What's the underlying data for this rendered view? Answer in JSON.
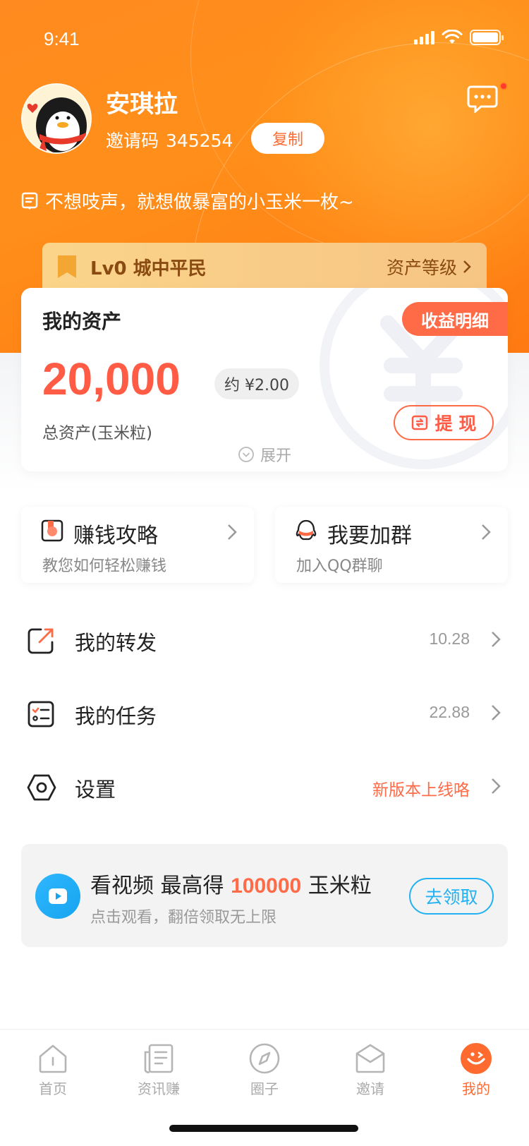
{
  "status_bar": {
    "time": "9:41"
  },
  "profile": {
    "name": "安琪拉",
    "invite_label": "邀请码",
    "invite_code": "345254",
    "copy_label": "复制",
    "signature": "不想吱声，就想做暴富的小玉米一枚~"
  },
  "level": {
    "title": "Lv0 城中平民",
    "link": "资产等级"
  },
  "assets": {
    "title": "我的资产",
    "detail_button": "收益明细",
    "value": "20,000",
    "approx": "约 ¥2.00",
    "subtitle": "总资产(玉米粒)",
    "withdraw_button": "提 现",
    "expand_label": "展开"
  },
  "quick_links": [
    {
      "title": "赚钱攻略",
      "subtitle": "教您如何轻松赚钱",
      "icon": "guide-icon"
    },
    {
      "title": "我要加群",
      "subtitle": "加入QQ群聊",
      "icon": "qq-icon"
    }
  ],
  "menu": [
    {
      "label": "我的转发",
      "value": "10.28",
      "icon": "share-icon"
    },
    {
      "label": "我的任务",
      "value": "22.88",
      "icon": "task-icon"
    },
    {
      "label": "设置",
      "value": "新版本上线咯",
      "icon": "settings-icon"
    }
  ],
  "promo": {
    "title_prefix": "看视频 最高得",
    "amount": "100000",
    "title_suffix": "玉米粒",
    "subtitle": "点击观看，翻倍领取无上限",
    "button": "去领取"
  },
  "tabs": [
    {
      "label": "首页",
      "icon": "home-icon"
    },
    {
      "label": "资讯赚",
      "icon": "news-icon"
    },
    {
      "label": "圈子",
      "icon": "compass-icon"
    },
    {
      "label": "邀请",
      "icon": "invite-icon"
    },
    {
      "label": "我的",
      "icon": "profile-icon",
      "active": true
    }
  ],
  "colors": {
    "primary": "#ff8a1f",
    "accent": "#ff6a47",
    "blue": "#22b1f2"
  }
}
